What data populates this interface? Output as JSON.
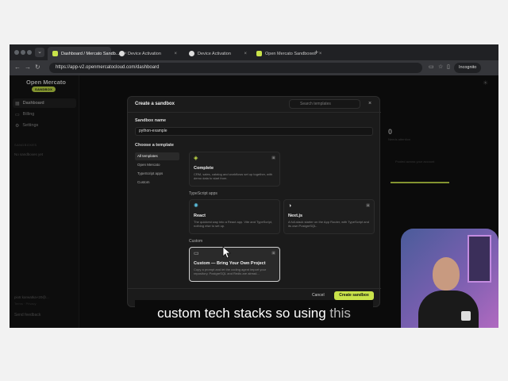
{
  "browser": {
    "tabs": [
      {
        "label": "Dashboard / Mercato Sandb...",
        "icon": "mercato-favicon",
        "active": true
      },
      {
        "label": "Device Activation",
        "icon": "github-favicon",
        "active": false
      },
      {
        "label": "Device Activation",
        "icon": "github-favicon",
        "active": false
      },
      {
        "label": "Open Mercato Sandboxes",
        "icon": "mercato-favicon",
        "active": false
      }
    ],
    "url": "https://app-v2.openmercatocloud.com/dashboard",
    "incognito_label": "Incognito"
  },
  "sidebar": {
    "brand": "Open Mercato",
    "badge": "SANDBOX",
    "items": [
      {
        "label": "Dashboard",
        "icon": "grid-icon"
      },
      {
        "label": "Billing",
        "icon": "card-icon"
      },
      {
        "label": "Settings",
        "icon": "gear-icon"
      }
    ],
    "section_label": "SANDBOXES",
    "empty_text": "No sandboxes yet",
    "user": "piotr.karwatka+20@...",
    "links": "Terms · Privacy",
    "feedback": "Send feedback"
  },
  "background": {
    "stat_value": "0",
    "stat_label": "Needs attention",
    "hint": "Pooled across your account"
  },
  "modal": {
    "title": "Create a sandbox",
    "search_placeholder": "Search templates",
    "name_label": "Sandbox name",
    "name_value": "python-example",
    "template_label": "Choose a template",
    "filters": [
      "All templates",
      "Open Mercato",
      "TypeScript apps",
      "Custom"
    ],
    "sections": {
      "typescript": "TypeScript apps",
      "custom": "Custom"
    },
    "cards": {
      "complete": {
        "title": "Complete",
        "desc": "CRM, sales, catalog and workflows set up together, with demo data to start from."
      },
      "react": {
        "title": "React",
        "desc": "The quickest way into a React app. Vite and TypeScript, nothing else to set up."
      },
      "next": {
        "title": "Next.js",
        "desc": "A full-stack starter on the App Router, with TypeScript and its own PostgreSQL."
      },
      "custom": {
        "title": "Custom — Bring Your Own Project",
        "desc": "Copy a prompt and let the coding agent import your repository. PostgreSQL and Redis are alread..."
      }
    },
    "cancel_label": "Cancel",
    "create_label": "Create sandbox"
  },
  "caption": {
    "text": "custom tech stacks so using",
    "highlight": "this"
  }
}
